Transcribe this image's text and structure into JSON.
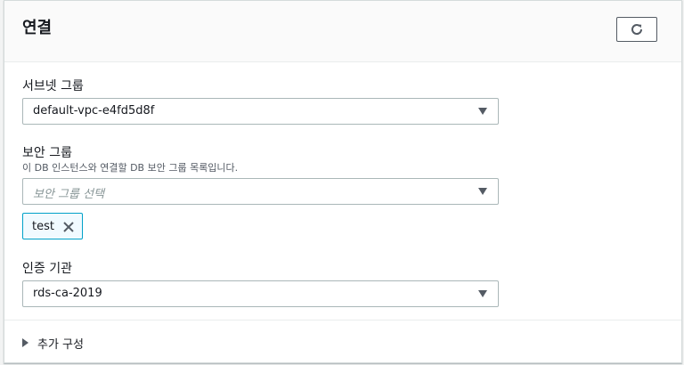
{
  "panel": {
    "title": "연결",
    "refresh_icon": "refresh-icon"
  },
  "subnet_group": {
    "label": "서브넷 그룹",
    "value": "default-vpc-e4fd5d8f"
  },
  "security_group": {
    "label": "보안 그룹",
    "description": "이 DB 인스턴스와 연결할 DB 보안 그룹 목록입니다.",
    "placeholder": "보안 그룹 선택",
    "tokens": [
      "test"
    ]
  },
  "certificate_authority": {
    "label": "인증 기관",
    "value": "rds-ca-2019"
  },
  "additional_config": {
    "label": "추가 구성"
  },
  "colors": {
    "token_border": "#00a1c9",
    "token_bg": "#f1faff",
    "header_bg": "#fafafa"
  }
}
